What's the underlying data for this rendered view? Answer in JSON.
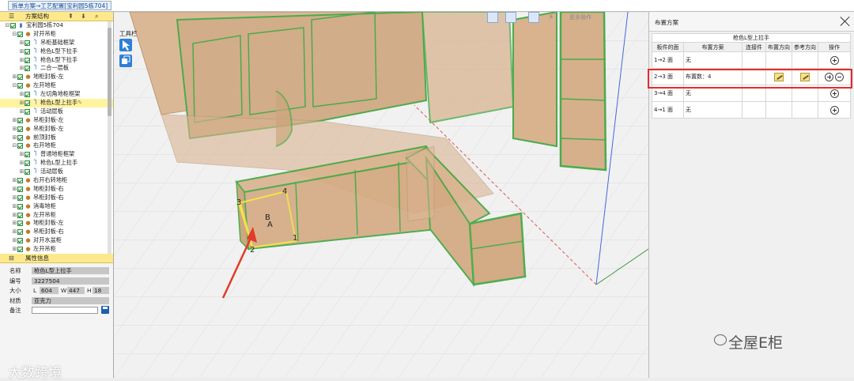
{
  "breadcrumb": "拆单方案→工艺配置[宝利园5栋704]",
  "left": {
    "tree_header": "方案结构",
    "tree": [
      {
        "label": "宝利园5栋704",
        "depth": 0,
        "toggle": "⊟",
        "icon": "node",
        "selected": false
      },
      {
        "label": "对开吊柜",
        "depth": 1,
        "toggle": "⊟",
        "icon": "cabinet",
        "selected": false
      },
      {
        "label": "吊柜基础框架",
        "depth": 2,
        "toggle": "⊞",
        "icon": "frame",
        "selected": false
      },
      {
        "label": "枪色L型下拉手",
        "depth": 2,
        "toggle": "⊞",
        "icon": "frame",
        "selected": false
      },
      {
        "label": "枪色L型下拉手",
        "depth": 2,
        "toggle": "⊞",
        "icon": "frame",
        "selected": false
      },
      {
        "label": "二合一层板",
        "depth": 2,
        "toggle": "⊞",
        "icon": "frame",
        "selected": false
      },
      {
        "label": "地柜封板-左",
        "depth": 1,
        "toggle": "⊞",
        "icon": "cabinet",
        "selected": false
      },
      {
        "label": "左开地柜",
        "depth": 1,
        "toggle": "⊟",
        "icon": "cabinet",
        "selected": false
      },
      {
        "label": "左切角地柜框架",
        "depth": 2,
        "toggle": "⊞",
        "icon": "frame",
        "selected": false
      },
      {
        "label": "枪色L型上拉手",
        "depth": 2,
        "toggle": "⊞",
        "icon": "frame",
        "selected": true
      },
      {
        "label": "活动层板",
        "depth": 2,
        "toggle": "⊞",
        "icon": "frame",
        "selected": false
      },
      {
        "label": "吊柜封板-左",
        "depth": 1,
        "toggle": "⊞",
        "icon": "cabinet",
        "selected": false
      },
      {
        "label": "吊柜封板-左",
        "depth": 1,
        "toggle": "⊞",
        "icon": "cabinet",
        "selected": false
      },
      {
        "label": "前顶封板",
        "depth": 1,
        "toggle": "⊞",
        "icon": "cabinet",
        "selected": false
      },
      {
        "label": "右开地柜",
        "depth": 1,
        "toggle": "⊟",
        "icon": "cabinet",
        "selected": false
      },
      {
        "label": "普通地柜框架",
        "depth": 2,
        "toggle": "⊞",
        "icon": "frame",
        "selected": false
      },
      {
        "label": "枪色L型上拉手",
        "depth": 2,
        "toggle": "⊞",
        "icon": "frame",
        "selected": false
      },
      {
        "label": "活动层板",
        "depth": 2,
        "toggle": "⊞",
        "icon": "frame",
        "selected": false
      },
      {
        "label": "右开右转地柜",
        "depth": 1,
        "toggle": "⊞",
        "icon": "cabinet",
        "selected": false
      },
      {
        "label": "地柜封板-右",
        "depth": 1,
        "toggle": "⊞",
        "icon": "cabinet",
        "selected": false
      },
      {
        "label": "吊柜封板-右",
        "depth": 1,
        "toggle": "⊞",
        "icon": "cabinet",
        "selected": false
      },
      {
        "label": "消毒地柜",
        "depth": 1,
        "toggle": "⊞",
        "icon": "cabinet",
        "selected": false
      },
      {
        "label": "左开吊柜",
        "depth": 1,
        "toggle": "⊞",
        "icon": "cabinet",
        "selected": false
      },
      {
        "label": "地柜封板-左",
        "depth": 1,
        "toggle": "⊞",
        "icon": "cabinet",
        "selected": false
      },
      {
        "label": "吊柜封板-右",
        "depth": 1,
        "toggle": "⊞",
        "icon": "cabinet",
        "selected": false
      },
      {
        "label": "对开水盆柜",
        "depth": 1,
        "toggle": "⊞",
        "icon": "cabinet",
        "selected": false
      },
      {
        "label": "左开吊柜",
        "depth": 1,
        "toggle": "⊞",
        "icon": "cabinet",
        "selected": false
      }
    ],
    "props_header": "属性信息",
    "props": {
      "name_label": "名称",
      "name": "枪色L型上拉手",
      "code_label": "编号",
      "code": "3227504",
      "size_label": "大小",
      "l_label": "L",
      "l": "604",
      "w_label": "W",
      "w": "447",
      "h_label": "H",
      "h": "18",
      "material_label": "材质",
      "material": "亚克力",
      "note_label": "备注"
    }
  },
  "viewport": {
    "toolbar_label": "工具栏",
    "float_label": "更多操作",
    "point_labels": [
      "1",
      "2",
      "3",
      "4",
      "B",
      "A"
    ]
  },
  "right": {
    "title": "布置方案",
    "caption": "枪色L型上拉手",
    "columns": [
      "板件的面",
      "布置方案",
      "连接件",
      "布置方向",
      "参考方向",
      "操作"
    ],
    "rows": [
      {
        "face": "1→2 面",
        "scheme": "无",
        "has_edit": false,
        "has_minus": false
      },
      {
        "face": "2→3 面",
        "scheme": "布置数：4",
        "has_edit": true,
        "has_minus": true
      },
      {
        "face": "3→4 面",
        "scheme": "无",
        "has_edit": false,
        "has_minus": false
      },
      {
        "face": "4→1 面",
        "scheme": "无",
        "has_edit": false,
        "has_minus": false
      }
    ]
  },
  "watermarks": {
    "left": "大数跨境",
    "right": "全屋E柜"
  },
  "colors": {
    "highlight": "#e52b2b",
    "cabinet_fill": "#d9b28c",
    "edge_green": "#3aa43a",
    "arrow": "#e23a2a"
  }
}
